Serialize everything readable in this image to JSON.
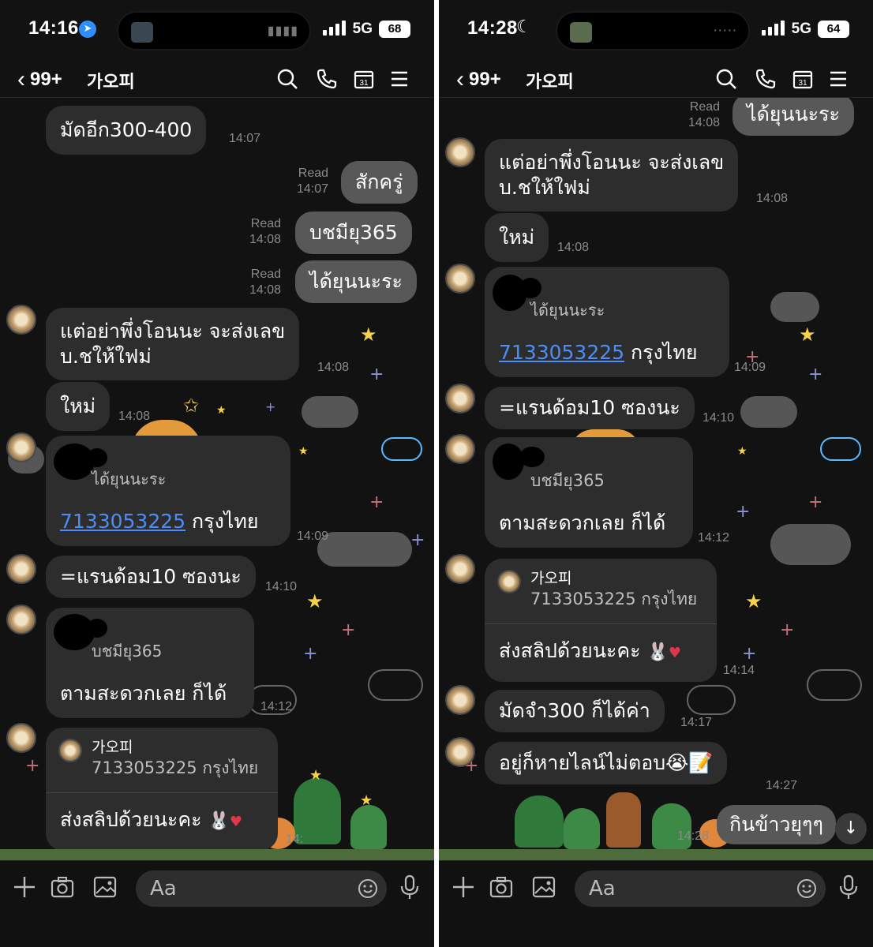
{
  "left": {
    "status": {
      "time": "14:16",
      "network": "5G",
      "battery": "68"
    },
    "header": {
      "back_count": "99+",
      "title": "가오피"
    },
    "messages": {
      "m1": {
        "text": "มัดอีก300-400",
        "time": "14:07"
      },
      "m2": {
        "text": "สักครู่",
        "read": "Read",
        "time": "14:07"
      },
      "m3": {
        "text": "บชมียุ365",
        "read": "Read",
        "time": "14:08"
      },
      "m4": {
        "text": "ได้ยุนนะระ",
        "read": "Read",
        "time": "14:08"
      },
      "m5": {
        "line1": "แต่อย่าพึ่งโอนนะ จะส่งเลข",
        "line2": "บ.ชให้ใฟม่",
        "time": "14:08"
      },
      "m6": {
        "text": "ใหม่",
        "time": "14:08"
      },
      "m7": {
        "quote": "ได้ยุนนะระ",
        "account": "7133053225",
        "bank": " กรุงไทย",
        "time": "14:09"
      },
      "m8": {
        "text": "=แรนด้อม10 ซองนะ",
        "time": "14:10"
      },
      "m9": {
        "quote": "บชมียุ365",
        "text": "ตามสะดวกเลย ก็ได้",
        "time": "14:12"
      },
      "m10": {
        "quote_name": "가오피",
        "quote_text": "7133053225 กรุงไทย",
        "text": "ส่งสลิปด้วยนะคะ",
        "time": "14:"
      }
    },
    "input": {
      "placeholder": "Aa"
    }
  },
  "right": {
    "status": {
      "time": "14:28",
      "network": "5G",
      "battery": "64"
    },
    "header": {
      "back_count": "99+",
      "title": "가오피"
    },
    "messages": {
      "r1": {
        "text": "ได้ยุนนะระ",
        "read": "Read",
        "time": "14:08"
      },
      "r2": {
        "line1": "แต่อย่าพึ่งโอนนะ จะส่งเลข",
        "line2": "บ.ชให้ใฟม่",
        "time": "14:08"
      },
      "r3": {
        "text": "ใหม่",
        "time": "14:08"
      },
      "r4": {
        "quote": "ได้ยุนนะระ",
        "account": "7133053225",
        "bank": " กรุงไทย",
        "time": "14:09"
      },
      "r5": {
        "text": "=แรนด้อม10 ซองนะ",
        "time": "14:10"
      },
      "r6": {
        "quote": "บชมียุ365",
        "text": "ตามสะดวกเลย ก็ได้",
        "time": "14:12"
      },
      "r7": {
        "quote_name": "가오피",
        "quote_text": "7133053225 กรุงไทย",
        "text": "ส่งสลิปด้วยนะคะ",
        "time": "14:14"
      },
      "r8": {
        "text": "มัดจำ300 ก็ได้ค่า",
        "time": "14:17"
      },
      "r9": {
        "text": "อยู่ก็หายไลน์ไม่ตอบ😭📝",
        "time": "14:27"
      },
      "r10": {
        "text": "กินข้าวยุๆๆ",
        "time": "14:28"
      }
    },
    "input": {
      "placeholder": "Aa"
    }
  },
  "colors": {
    "background": "#121212",
    "bubble_other": "#2d2d2d",
    "bubble_mine": "#585858",
    "link": "#4d8ef5",
    "location": "#2f8dfd"
  },
  "icons": [
    "chevron-left-icon",
    "search-icon",
    "phone-icon",
    "calendar-icon",
    "menu-icon",
    "plus-icon",
    "camera-icon",
    "image-icon",
    "smile-icon",
    "mic-icon",
    "location-arrow-icon",
    "moon-icon",
    "arrow-down-icon"
  ]
}
